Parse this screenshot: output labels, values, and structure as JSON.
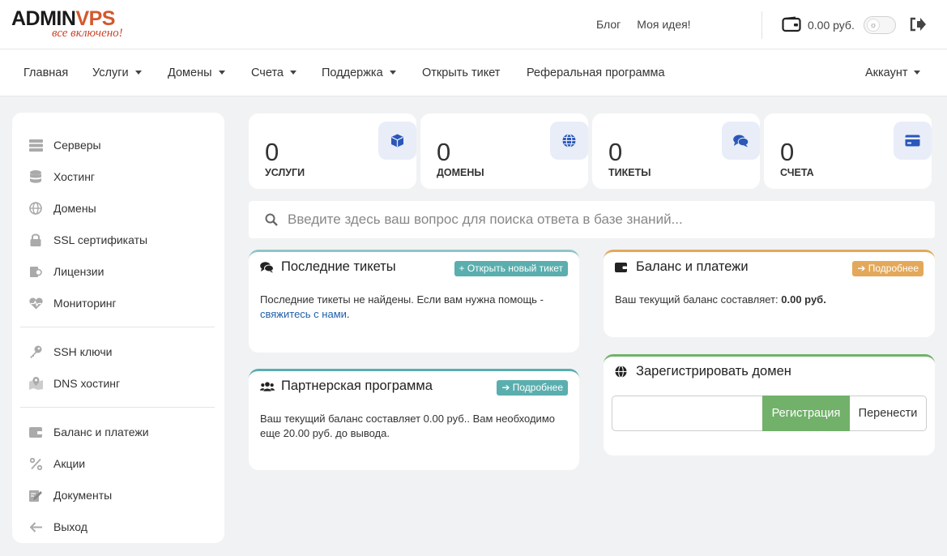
{
  "logo": {
    "main_a": "ADMIN",
    "main_b": "VPS",
    "tagline": "все включено!"
  },
  "top": {
    "links": [
      "Блог",
      "Моя идея!"
    ],
    "balance": "0.00 руб."
  },
  "nav": {
    "items": [
      {
        "label": "Главная"
      },
      {
        "label": "Услуги"
      },
      {
        "label": "Домены"
      },
      {
        "label": "Счета"
      },
      {
        "label": "Поддержка"
      },
      {
        "label": "Открыть тикет"
      },
      {
        "label": "Реферальная программа"
      }
    ],
    "account": "Аккаунт"
  },
  "sidebar": {
    "items": [
      {
        "label": "Серверы"
      },
      {
        "label": "Хостинг"
      },
      {
        "label": "Домены"
      },
      {
        "label": "SSL сертификаты"
      },
      {
        "label": "Лицензии"
      },
      {
        "label": "Мониторинг"
      },
      {
        "label": "SSH ключи"
      },
      {
        "label": "DNS хостинг"
      },
      {
        "label": "Баланс и платежи"
      },
      {
        "label": "Акции"
      },
      {
        "label": "Документы"
      },
      {
        "label": "Выход"
      }
    ]
  },
  "stats": [
    {
      "value": "0",
      "label": "УСЛУГИ"
    },
    {
      "value": "0",
      "label": "ДОМЕНЫ"
    },
    {
      "value": "0",
      "label": "ТИКЕТЫ"
    },
    {
      "value": "0",
      "label": "СЧЕТА"
    }
  ],
  "search": {
    "placeholder": "Введите здесь ваш вопрос для поиска ответа в базе знаний..."
  },
  "tickets": {
    "title": "Последние тикеты",
    "button": "Открыть новый тикет",
    "text": "Последние тикеты не найдены. Если вам нужна помощь -",
    "link": "свяжитесь с нами",
    "after_link": "."
  },
  "partner": {
    "title": "Партнерская программа",
    "button": "Подробнее",
    "line1": "Ваш текущий баланс составляет 0.00 руб.. Вам необходимо",
    "line2": "еще 20.00 руб. до вывода."
  },
  "balance": {
    "title": "Баланс и платежи",
    "button": "Подробнее",
    "text": "Ваш текущий баланс составляет: ",
    "amount": "0.00 руб."
  },
  "domain": {
    "title": "Зарегистрировать домен",
    "register": "Регистрация",
    "transfer": "Перенести"
  },
  "colors": {
    "accent_blue": "#2a57b8",
    "teal": "#5aaeae",
    "orange": "#e3a85a",
    "green": "#72b16a"
  }
}
